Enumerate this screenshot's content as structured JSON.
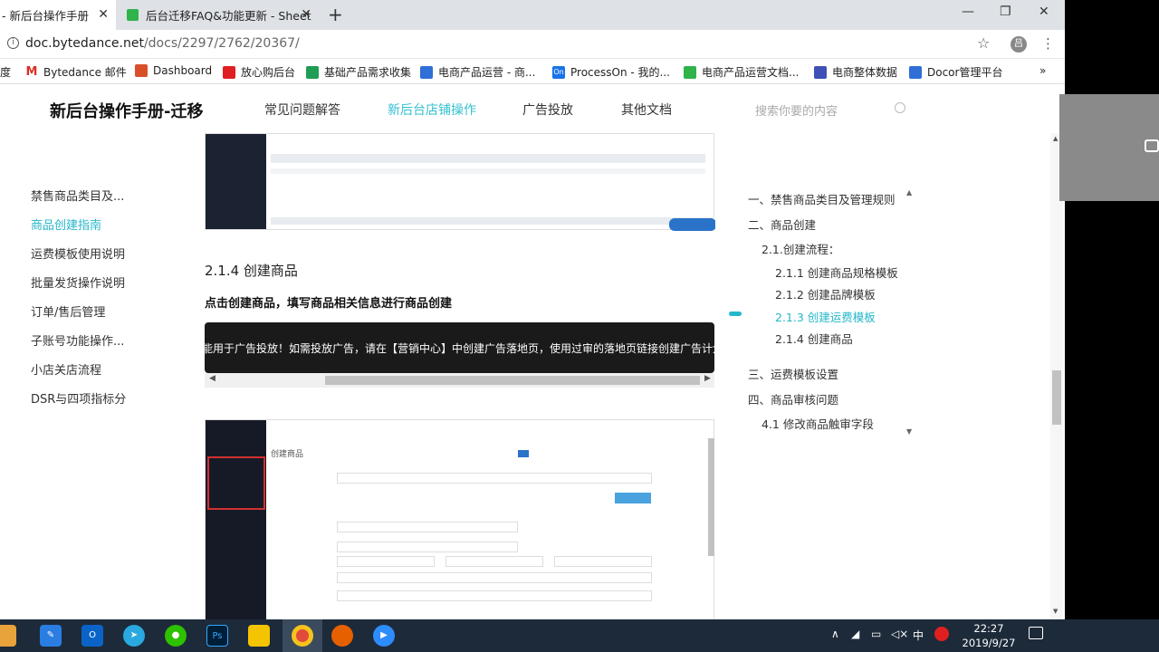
{
  "browser": {
    "tabs": [
      {
        "label": "- 新后台操作手册"
      },
      {
        "label": "后台迁移FAQ&功能更新 - Sheet"
      }
    ],
    "window_controls": {
      "minimize": "—",
      "maximize": "❐",
      "close": "✕"
    },
    "url_host": "doc.bytedance.net",
    "url_path": "/docs/2297/2762/20367/",
    "profile_initial": "吕",
    "bookmarks": [
      {
        "label": "度",
        "color": "#ffffff"
      },
      {
        "label": "Bytedance 邮件",
        "color": "#d93025"
      },
      {
        "label": "Dashboard",
        "color": "#d8502a"
      },
      {
        "label": "放心购后台",
        "color": "#e02020"
      },
      {
        "label": "基础产品需求收集",
        "color": "#1f9d55"
      },
      {
        "label": "电商产品运营 - 商...",
        "color": "#2f6fd6"
      },
      {
        "label": "ProcessOn - 我的...",
        "color": "#1a73e8"
      },
      {
        "label": "电商产品运营文档...",
        "color": "#2fb34a"
      },
      {
        "label": "电商整体数据",
        "color": "#3f51b5"
      },
      {
        "label": "Docor管理平台",
        "color": "#2f6fd6"
      }
    ],
    "bookmarks_more": "»"
  },
  "site": {
    "brand": "新后台操作手册-迁移",
    "nav": [
      "常见问题解答",
      "新后台店铺操作",
      "广告投放",
      "其他文档"
    ],
    "search_placeholder": "搜索你要的内容"
  },
  "sidebar": {
    "items": [
      "禁售商品类目及...",
      "商品创建指南",
      "运费模板使用说明",
      "批量发货操作说明",
      "订单/售后管理",
      "子账号功能操作...",
      "小店关店流程",
      "DSR与四项指标分"
    ]
  },
  "main": {
    "section_heading": "2.1.4 创建商品",
    "instruction": "点击创建商品，填写商品相关信息进行商品创建",
    "banner_text": "能用于广告投放！如需投放广告，请在【营销中心】中创建广告落地页，使用过审的落地页链接创建广告计划",
    "screenshot_title": "创建商品"
  },
  "toc": {
    "items": [
      {
        "label": "一、禁售商品类目及管理规则"
      },
      {
        "label": "二、商品创建"
      },
      {
        "label": "2.1.创建流程："
      },
      {
        "label": "2.1.1 创建商品规格模板"
      },
      {
        "label": "2.1.2 创建品牌模板"
      },
      {
        "label": "2.1.3 创建运费模板"
      },
      {
        "label": "2.1.4 创建商品"
      },
      {
        "label": "三、运费模板设置"
      },
      {
        "label": "四、商品审核问题"
      },
      {
        "label": "4.1 修改商品触审字段"
      }
    ]
  },
  "taskbar": {
    "time": "22:27",
    "date": "2019/9/27",
    "ime": "中"
  }
}
